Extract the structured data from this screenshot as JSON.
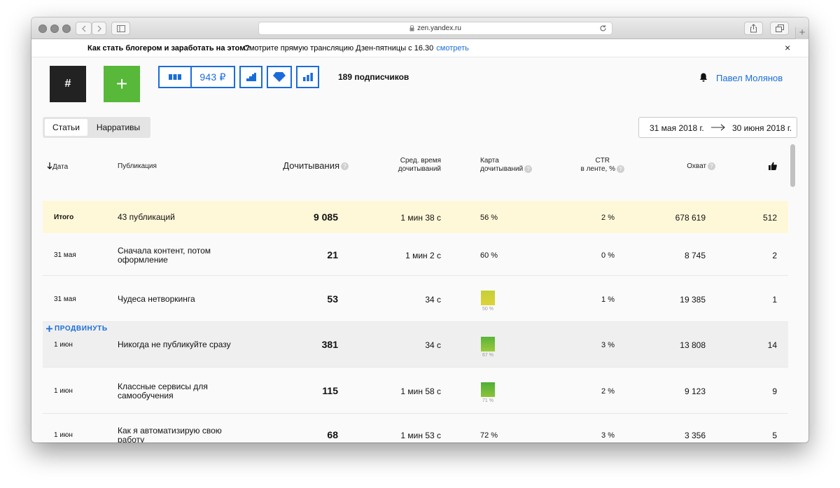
{
  "browser": {
    "url": "zen.yandex.ru",
    "new_tab_label": "+"
  },
  "announcement": {
    "title": "Как стать блогером и заработать на этом?",
    "text": "Смотрите прямую трансляцию Дзен-пятницы с 16.30",
    "link": "смотреть",
    "close": "×"
  },
  "header": {
    "hash_label": "#",
    "plus_label": "+",
    "money": "943 ₽",
    "subscribers": "189 подписчиков",
    "user_name": "Павел Молянов",
    "icons": [
      "dashboard-icon",
      "stairs-chart-icon",
      "diamond-icon",
      "bar-chart-icon",
      "bell-icon"
    ]
  },
  "tabs": [
    "Статьи",
    "Нарративы"
  ],
  "date_range": {
    "from": "31 мая 2018 г.",
    "to": "30 июня 2018 г."
  },
  "table": {
    "columns": {
      "date": "Дата",
      "publication": "Публикация",
      "reads": "Дочитывания",
      "avg_time": [
        "Сред. время",
        "дочитываний"
      ],
      "map": [
        "Карта",
        "дочитываний"
      ],
      "ctr": [
        "CTR",
        "в ленте, %"
      ],
      "reach": "Охват",
      "likes": "like-icon",
      "help": "?"
    },
    "total": {
      "label": "Итого",
      "publications": "43 публикаций",
      "reads": "9 085",
      "avg_time": "1 мин 38 с",
      "map": "56 %",
      "ctr": "2 %",
      "reach": "678 619",
      "likes": "512"
    },
    "promote_label": "ПРОДВИНУТЬ",
    "rows": [
      {
        "date": "31 мая",
        "title": [
          "Сначала контент, потом",
          "оформление"
        ],
        "reads": "21",
        "avg_time": "1 мин 2 с",
        "map": "60 %",
        "ctr": "0 %",
        "reach": "8 745",
        "likes": "2"
      },
      {
        "date": "31 мая",
        "title": [
          "Чудеса нетворкинга"
        ],
        "reads": "53",
        "avg_time": "34 с",
        "map": "50 %",
        "map_color": "#c9d43a",
        "ctr": "1 %",
        "reach": "19 385",
        "likes": "1"
      },
      {
        "date": "1 июн",
        "title": [
          "Никогда не публикуйте сразу"
        ],
        "reads": "381",
        "avg_time": "34 с",
        "map": "67 %",
        "map_color": "#62b63a",
        "ctr": "3 %",
        "reach": "13 808",
        "likes": "14"
      },
      {
        "date": "1 июн",
        "title": [
          "Классные сервисы для",
          "самообучения"
        ],
        "reads": "115",
        "avg_time": "1 мин 58 с",
        "map": "71 %",
        "map_color": "#4fae38",
        "ctr": "2 %",
        "reach": "9 123",
        "likes": "9"
      },
      {
        "date": "1 июн",
        "title": [
          "Как я автоматизирую свою",
          "работу"
        ],
        "reads": "68",
        "avg_time": "1 мин 53 с",
        "map": "72 %",
        "ctr": "3 %",
        "reach": "3 356",
        "likes": "5"
      }
    ]
  },
  "colors": {
    "accent": "#1a6dd9",
    "green_button": "#57b83a",
    "dark_button": "#222222",
    "total_row": "#fff8d8"
  }
}
